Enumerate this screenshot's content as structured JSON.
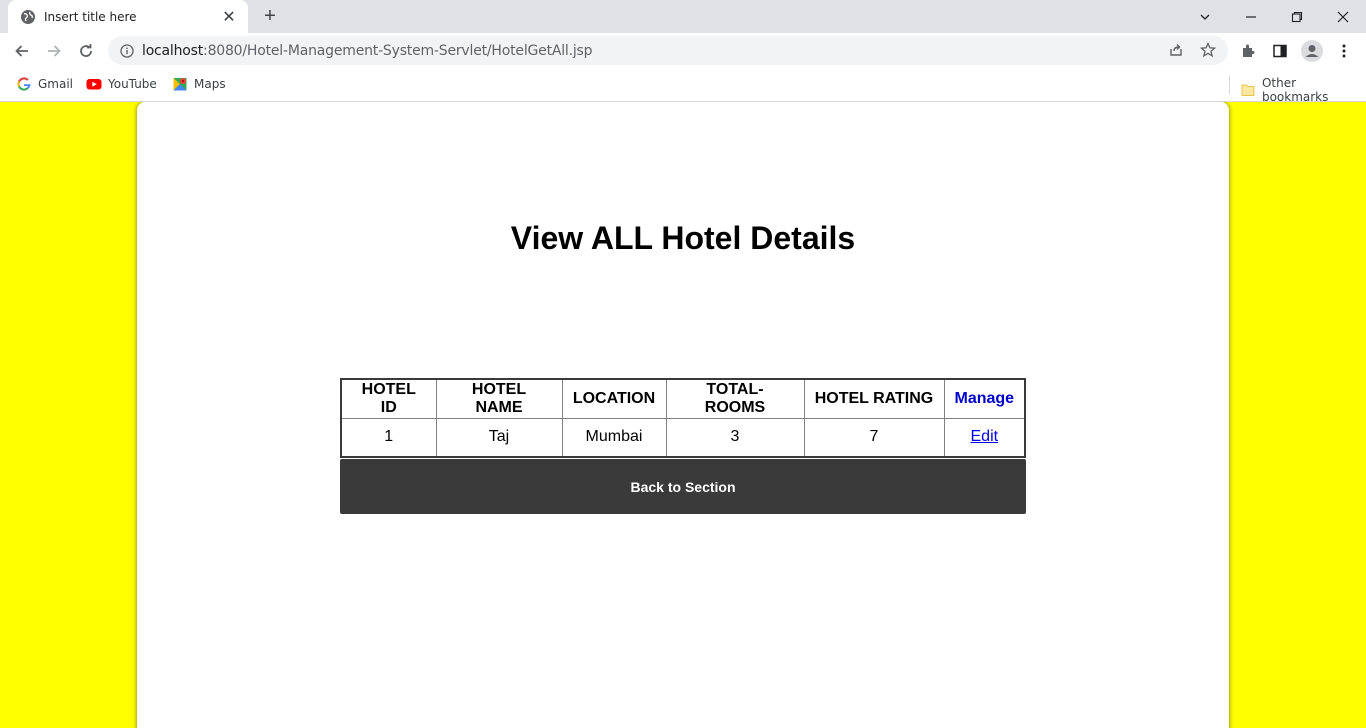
{
  "browser": {
    "tab_title": "Insert title here",
    "url_host": "localhost",
    "url_rest": ":8080/Hotel-Management-System-Servlet/HotelGetAll.jsp",
    "bookmarks": [
      "Gmail",
      "YouTube",
      "Maps"
    ],
    "other_bookmarks": "Other bookmarks"
  },
  "page": {
    "title": "View ALL Hotel Details",
    "table": {
      "headers": [
        "HOTEL ID",
        "HOTEL NAME",
        "LOCATION",
        "TOTAL-ROOMS",
        "HOTEL RATING",
        "Manage"
      ],
      "rows": [
        [
          "1",
          "Taj",
          "Mumbai",
          "3",
          "7",
          "Edit"
        ]
      ]
    },
    "back_button": "Back to Section"
  },
  "colors": {
    "background": "#ffff00",
    "button": "#3a3a3a",
    "manage_header": "#0000cc",
    "link": "#0000ee"
  }
}
